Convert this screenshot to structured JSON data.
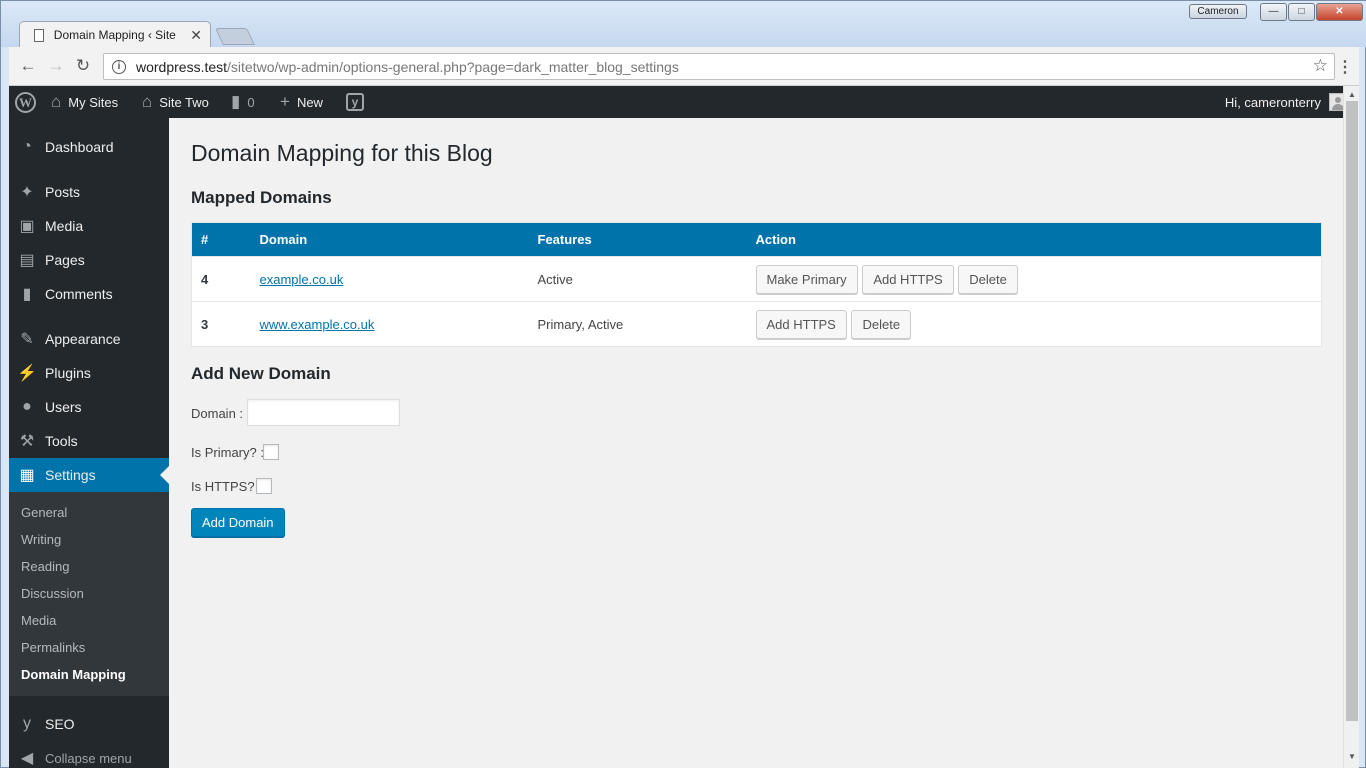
{
  "browser": {
    "tab_title": "Domain Mapping ‹ Site T",
    "tab_close": "✕",
    "user_badge": "Cameron",
    "url_host": "wordpress.test",
    "url_path": "/sitetwo/wp-admin/options-general.php?page=dark_matter_blog_settings",
    "icons": {
      "back": "arrow-left-icon",
      "forward": "arrow-right-icon",
      "reload": "reload-icon",
      "info": "info-icon",
      "star": "star-icon",
      "menu": "kebab-menu-icon"
    }
  },
  "adminbar": {
    "my_sites": "My Sites",
    "site_name": "Site Two",
    "comments_count": "0",
    "new_label": "New",
    "greeting": "Hi, cameronterry"
  },
  "sidebar": {
    "items": [
      {
        "label": "Dashboard",
        "icon": "dashboard-icon"
      },
      {
        "label": "Posts",
        "icon": "pin-icon"
      },
      {
        "label": "Media",
        "icon": "media-icon"
      },
      {
        "label": "Pages",
        "icon": "pages-icon"
      },
      {
        "label": "Comments",
        "icon": "comment-icon"
      },
      {
        "label": "Appearance",
        "icon": "brush-icon"
      },
      {
        "label": "Plugins",
        "icon": "plug-icon"
      },
      {
        "label": "Users",
        "icon": "user-icon"
      },
      {
        "label": "Tools",
        "icon": "wrench-icon"
      },
      {
        "label": "Settings",
        "icon": "settings-icon"
      },
      {
        "label": "SEO",
        "icon": "yoast-icon"
      },
      {
        "label": "Collapse menu",
        "icon": "collapse-icon"
      }
    ],
    "submenu": [
      "General",
      "Writing",
      "Reading",
      "Discussion",
      "Media",
      "Permalinks",
      "Domain Mapping"
    ]
  },
  "main": {
    "title": "Domain Mapping for this Blog",
    "mapped_heading": "Mapped Domains",
    "table": {
      "headers": [
        "#",
        "Domain",
        "Features",
        "Action"
      ],
      "rows": [
        {
          "num": "4",
          "domain": "example.co.uk",
          "features": "Active",
          "actions": [
            "Make Primary",
            "Add HTTPS",
            "Delete"
          ]
        },
        {
          "num": "3",
          "domain": "www.example.co.uk",
          "features": "Primary, Active",
          "actions": [
            "Add HTTPS",
            "Delete"
          ]
        }
      ]
    },
    "add_heading": "Add New Domain",
    "form": {
      "domain_label": "Domain :",
      "domain_value": "",
      "primary_label": "Is Primary? :",
      "https_label": "Is HTTPS? :",
      "submit_label": "Add Domain"
    }
  },
  "colors": {
    "admin_dark": "#23282d",
    "accent": "#0073aa",
    "button_primary": "#0085ba",
    "content_bg": "#f1f1f1"
  }
}
